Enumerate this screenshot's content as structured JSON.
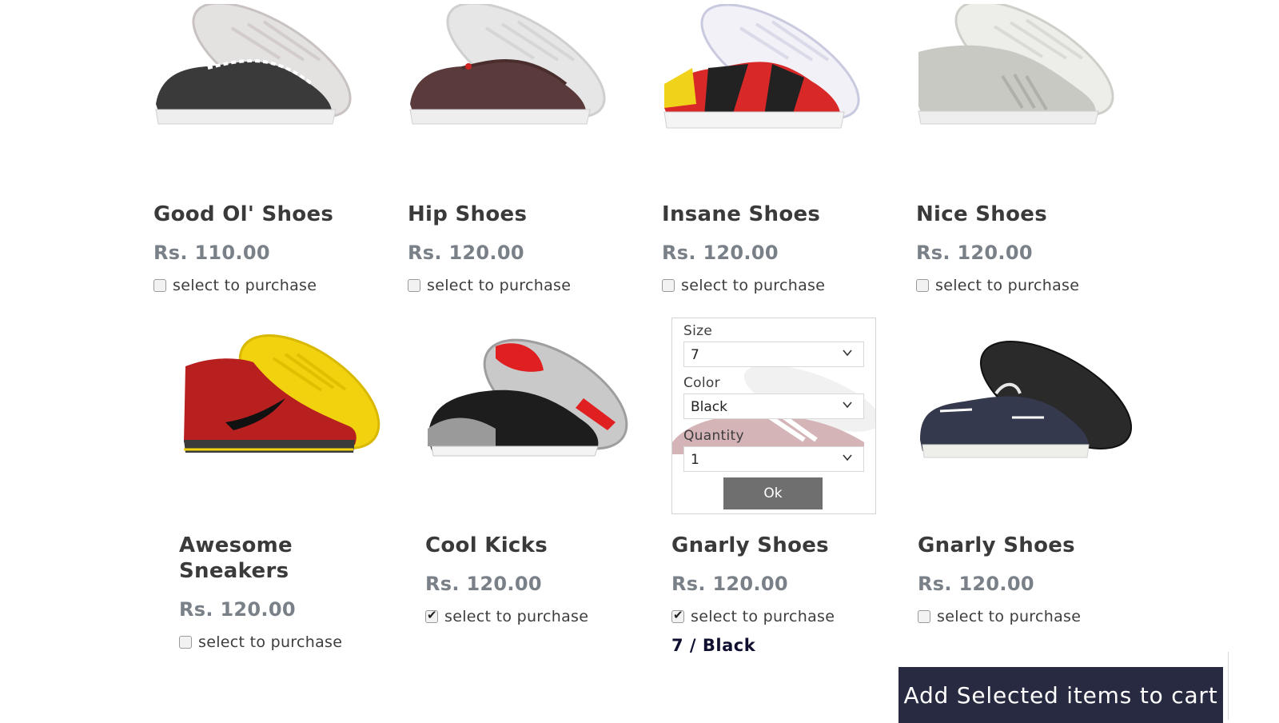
{
  "products": [
    {
      "name": "Good Ol' Shoes",
      "price": "Rs. 110.00",
      "select_label": "select to purchase",
      "checked": false
    },
    {
      "name": "Hip Shoes",
      "price": "Rs. 120.00",
      "select_label": "select to purchase",
      "checked": false
    },
    {
      "name": "Insane Shoes",
      "price": "Rs. 120.00",
      "select_label": "select to purchase",
      "checked": false
    },
    {
      "name": "Nice Shoes",
      "price": "Rs. 120.00",
      "select_label": "select to purchase",
      "checked": false
    },
    {
      "name": "Awesome Sneakers",
      "price": "Rs. 120.00",
      "select_label": "select to purchase",
      "checked": false
    },
    {
      "name": "Cool Kicks",
      "price": "Rs. 120.00",
      "select_label": "select to purchase",
      "checked": true
    },
    {
      "name": "Gnarly Shoes",
      "price": "Rs. 120.00",
      "select_label": "select to purchase",
      "checked": true,
      "variant": "7 / Black"
    },
    {
      "name": "Gnarly Shoes",
      "price": "Rs. 120.00",
      "select_label": "select to purchase",
      "checked": false
    }
  ],
  "options_popup": {
    "size_label": "Size",
    "size_value": "7",
    "color_label": "Color",
    "color_value": "Black",
    "quantity_label": "Quantity",
    "quantity_value": "1",
    "ok_label": "Ok"
  },
  "cart_button_label": "Add Selected items to cart",
  "colors": {
    "cart_button_bg": "#272a40",
    "price_text": "#7a8088",
    "ok_button_bg": "#6f6f6f"
  }
}
